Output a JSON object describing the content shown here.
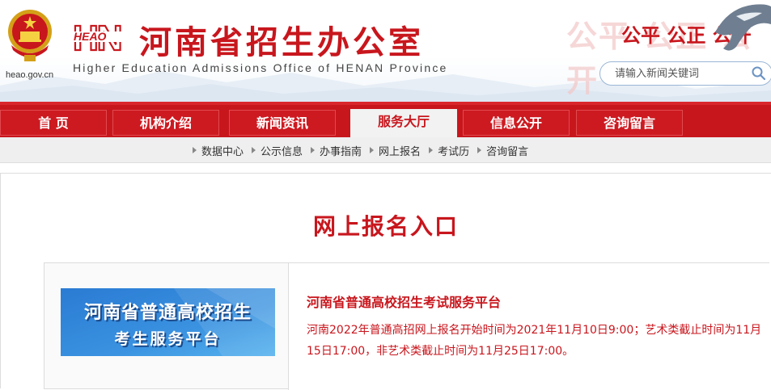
{
  "header": {
    "domain": "heao.gov.cn",
    "logo_text": "HEAO",
    "site_title": "河南省招生办公室",
    "site_subtitle": "Higher Education Admissions Office of HENAN Province",
    "slogan_background": "公平 公正 公开",
    "slogan": "公平 公正 公开",
    "search": {
      "placeholder": "请输入新闻关键词",
      "icon": "search-icon"
    }
  },
  "nav": {
    "items": [
      {
        "label": "首 页"
      },
      {
        "label": "机构介绍"
      },
      {
        "label": "新闻资讯"
      },
      {
        "label": "服务大厅",
        "active": true
      },
      {
        "label": "信息公开"
      },
      {
        "label": "咨询留言"
      }
    ]
  },
  "subnav": {
    "items": [
      {
        "label": "数据中心"
      },
      {
        "label": "公示信息"
      },
      {
        "label": "办事指南"
      },
      {
        "label": "网上报名"
      },
      {
        "label": "考试历"
      },
      {
        "label": "咨询留言"
      }
    ]
  },
  "main": {
    "page_title": "网上报名入口",
    "entry": {
      "banner_line1": "河南省普通高校招生",
      "banner_line2": "考生服务平台",
      "title": "河南省普通高校招生考试服务平台",
      "description": "河南2022年普通高招网上报名开始时间为2021年11月10日9:00；艺术类截止时间为11月15日17:00，非艺术类截止时间为11月25日17:00。"
    }
  },
  "colors": {
    "brand_red": "#c8161d",
    "nav_active_bg": "#f2f2f2",
    "banner_blue": "#2f7fd0"
  }
}
